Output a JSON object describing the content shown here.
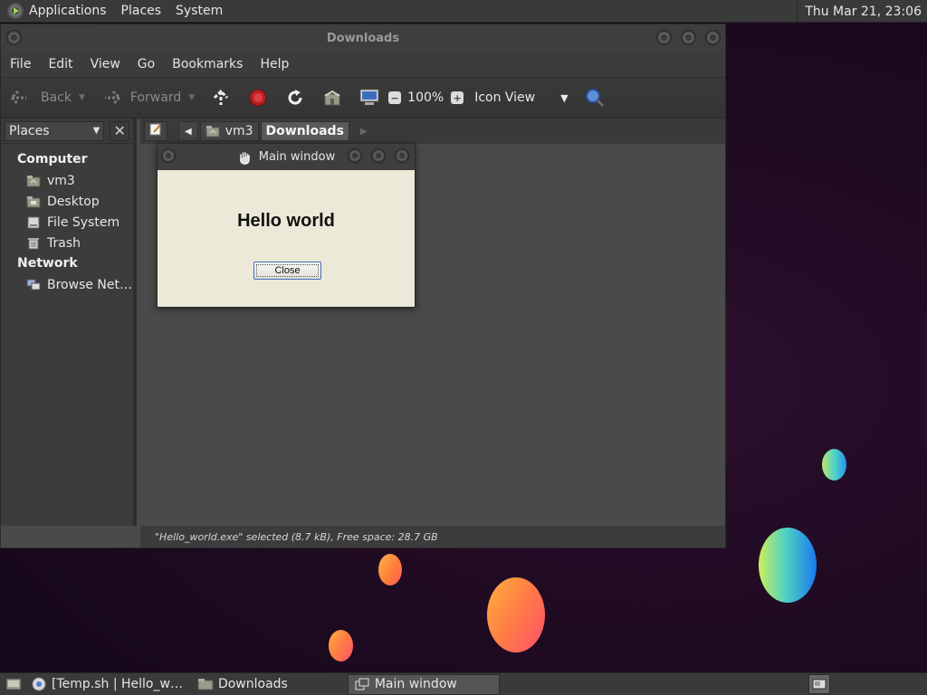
{
  "top_panel": {
    "menus": [
      "Applications",
      "Places",
      "System"
    ],
    "clock": "Thu Mar 21, 23:06"
  },
  "file_manager": {
    "title": "Downloads",
    "menubar": [
      "File",
      "Edit",
      "View",
      "Go",
      "Bookmarks",
      "Help"
    ],
    "toolbar": {
      "back_label": "Back",
      "forward_label": "Forward",
      "zoom_level": "100%",
      "view_mode": "Icon View"
    },
    "sidebar": {
      "selector_label": "Places",
      "groups": [
        {
          "label": "Computer",
          "items": [
            {
              "label": "vm3",
              "icon": "home-folder-icon"
            },
            {
              "label": "Desktop",
              "icon": "desktop-folder-icon"
            },
            {
              "label": "File System",
              "icon": "drive-icon"
            },
            {
              "label": "Trash",
              "icon": "trash-icon"
            }
          ]
        },
        {
          "label": "Network",
          "items": [
            {
              "label": "Browse Net…",
              "icon": "network-icon"
            }
          ]
        }
      ]
    },
    "pathbar": [
      "vm3",
      "Downloads"
    ],
    "status": "\"Hello_world.exe\" selected (8.7 kB), Free space: 28.7 GB"
  },
  "dialog": {
    "title": "Main window",
    "message": "Hello world",
    "close_label": "Close"
  },
  "taskbar": {
    "tasks": [
      {
        "label": "[Temp.sh | Hello_w…",
        "icon": "chrome-icon"
      },
      {
        "label": "Downloads",
        "icon": "folder-icon"
      },
      {
        "label": "Main window",
        "icon": "window-icon"
      }
    ]
  },
  "colors": {
    "panel": "#3a3a3a",
    "window": "#4a4a4a",
    "dialog_bg": "#ece9d8",
    "desktop": "#1d0a20"
  }
}
